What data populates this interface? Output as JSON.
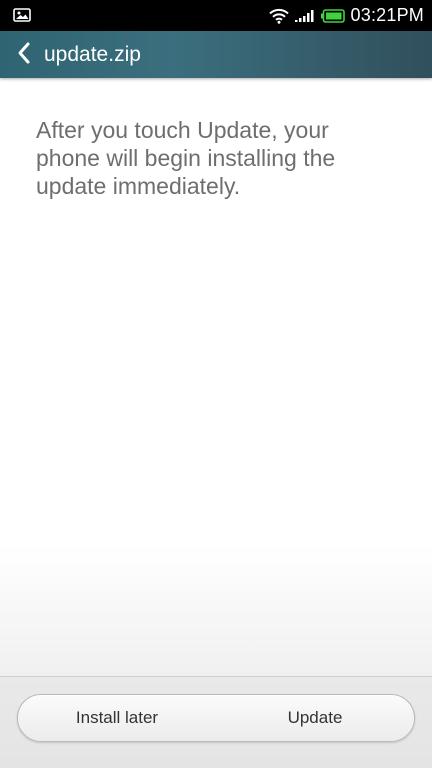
{
  "status_bar": {
    "time": "03:21PM",
    "notification_icon": "image-icon",
    "wifi_icon": "wifi-icon",
    "signal_icon": "signal-icon",
    "battery_icon": "battery-icon",
    "battery_color": "#3fd43f"
  },
  "title_bar": {
    "back_icon": "chevron-left-icon",
    "title": "update.zip",
    "background_color": "#2f6473"
  },
  "content": {
    "message": "After you touch Update, your phone will begin installing the update immediately."
  },
  "actions": {
    "install_later_label": "Install later",
    "update_label": "Update"
  }
}
